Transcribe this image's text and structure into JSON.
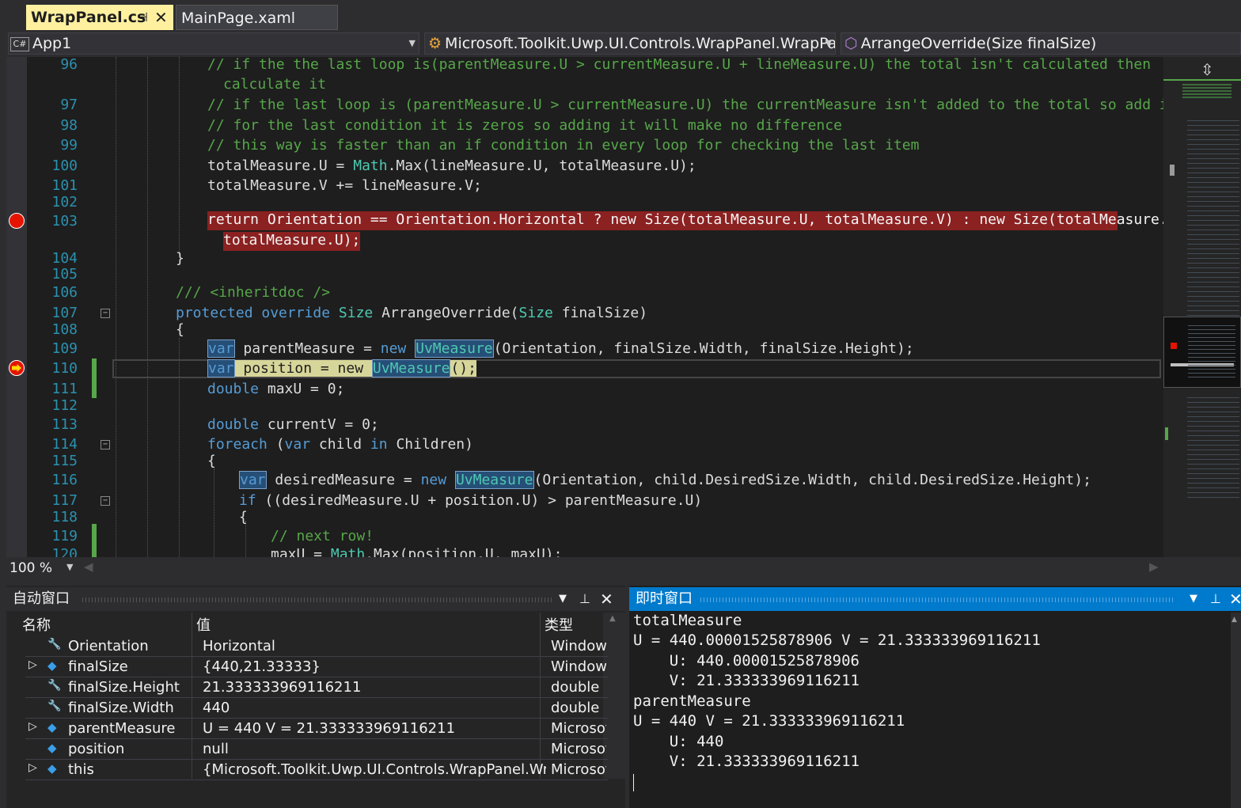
{
  "tabs": [
    {
      "label": "WrapPanel.cs",
      "pin": "⊣",
      "close": "✕"
    },
    {
      "label": "MainPage.xaml"
    }
  ],
  "nav": {
    "project": "App1",
    "class": "Microsoft.Toolkit.Uwp.UI.Controls.WrapPanel.WrapPan",
    "member": "ArrangeOverride(Size finalSize)"
  },
  "editor": {
    "line_numbers": [
      "96",
      "97",
      "98",
      "99",
      "100",
      "101",
      "102",
      "103",
      "104",
      "105",
      "106",
      "107",
      "108",
      "109",
      "110",
      "111",
      "112",
      "113",
      "114",
      "115",
      "116",
      "117",
      "118",
      "119",
      "120"
    ],
    "breakpoint_line": "103",
    "current_line": "110",
    "zoom": "100 %"
  },
  "autos": {
    "title": "自动窗口",
    "headers": {
      "name": "名称",
      "value": "值",
      "type": "类型"
    },
    "rows": [
      {
        "name": "Orientation",
        "value": "Horizontal",
        "type": "Windows",
        "expand": "",
        "icon": "wrench-icon"
      },
      {
        "name": "finalSize",
        "value": "{440,21.33333}",
        "type": "Windows",
        "expand": "▷",
        "icon": "cube-icon"
      },
      {
        "name": "finalSize.Height",
        "value": "21.333333969116211",
        "type": "double",
        "expand": "",
        "icon": "wrench-icon"
      },
      {
        "name": "finalSize.Width",
        "value": "440",
        "type": "double",
        "expand": "",
        "icon": "wrench-icon"
      },
      {
        "name": "parentMeasure",
        "value": "U = 440 V = 21.333333969116211",
        "type": "Microsof",
        "expand": "▷",
        "icon": "cube-icon"
      },
      {
        "name": "position",
        "value": "null",
        "type": "Microsof",
        "expand": "",
        "icon": "cube-icon"
      },
      {
        "name": "this",
        "value": "{Microsoft.Toolkit.Uwp.UI.Controls.WrapPanel.WrapPane",
        "type": "Microsof",
        "expand": "▷",
        "icon": "cube-icon"
      }
    ]
  },
  "immediate": {
    "title": "即时窗口",
    "lines": [
      "totalMeasure",
      "U = 440.00001525878906 V = 21.333333969116211",
      "    U: 440.00001525878906",
      "    V: 21.333333969116211",
      "parentMeasure",
      "U = 440 V = 21.333333969116211",
      "    U: 440",
      "    V: 21.333333969116211"
    ]
  }
}
